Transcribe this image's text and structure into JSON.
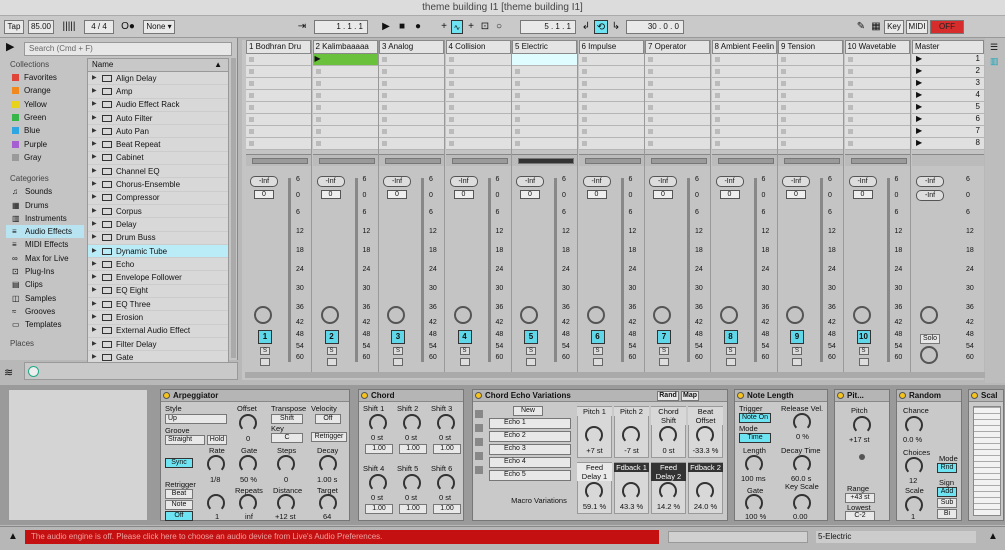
{
  "window": {
    "title": "theme building I1  [theme building I1]"
  },
  "toolbar": {
    "tap": "Tap",
    "tempo": "85.00",
    "meter": "4 / 4",
    "oo": "O●",
    "none": "None ▾",
    "pos1": "1 .   1 .   1",
    "pos2": "5 .   1 .   1",
    "pos3": "30 .   0 .   0",
    "key": "Key",
    "midi": "MIDI",
    "off": "OFF"
  },
  "browser": {
    "search_placeholder": "Search (Cmd + F)",
    "collections_header": "Collections",
    "collections": [
      {
        "label": "Favorites",
        "color": "#e0453a"
      },
      {
        "label": "Orange",
        "color": "#f08a1f"
      },
      {
        "label": "Yellow",
        "color": "#e8d21a"
      },
      {
        "label": "Green",
        "color": "#36b54a"
      },
      {
        "label": "Blue",
        "color": "#2fa6e0"
      },
      {
        "label": "Purple",
        "color": "#a65fd0"
      },
      {
        "label": "Gray",
        "color": "#9a9a9a"
      }
    ],
    "categories_header": "Categories",
    "categories": [
      "Sounds",
      "Drums",
      "Instruments",
      "Audio Effects",
      "MIDI Effects",
      "Max for Live",
      "Plug-Ins",
      "Clips",
      "Samples",
      "Grooves",
      "Templates"
    ],
    "places_header": "Places",
    "list_header": "Name",
    "items": [
      "Align Delay",
      "Amp",
      "Audio Effect Rack",
      "Auto Filter",
      "Auto Pan",
      "Beat Repeat",
      "Cabinet",
      "Channel EQ",
      "Chorus-Ensemble",
      "Compressor",
      "Corpus",
      "Delay",
      "Drum Buss",
      "Dynamic Tube",
      "Echo",
      "Envelope Follower",
      "EQ Eight",
      "EQ Three",
      "Erosion",
      "External Audio Effect",
      "Filter Delay",
      "Gate"
    ]
  },
  "tracks": [
    {
      "name": "1 Bodhran Dru",
      "num": "1"
    },
    {
      "name": "2 Kalimbaaaaa",
      "num": "2"
    },
    {
      "name": "3 Analog",
      "num": "3"
    },
    {
      "name": "4 Collision",
      "num": "4"
    },
    {
      "name": "5 Electric",
      "num": "5"
    },
    {
      "name": "6 Impulse",
      "num": "6"
    },
    {
      "name": "7 Operator",
      "num": "7"
    },
    {
      "name": "8 Ambient Feelin",
      "num": "8"
    },
    {
      "name": "9 Tension",
      "num": "9"
    },
    {
      "name": "10 Wavetable",
      "num": "10"
    }
  ],
  "mixer": {
    "inf": "-Inf",
    "zero": "0",
    "s": "S",
    "scale": [
      "6",
      "0",
      "6",
      "12",
      "18",
      "24",
      "30",
      "36",
      "42",
      "48",
      "54",
      "60"
    ]
  },
  "master": {
    "name": "Master",
    "scenes": [
      "1",
      "2",
      "3",
      "4",
      "5",
      "6",
      "7",
      "8"
    ],
    "inf": "-Inf",
    "solo": "Solo"
  },
  "devices": {
    "arp": {
      "title": "Arpeggiator",
      "style": "Style",
      "style_v": "Up",
      "groove": "Groove",
      "groove_v": "Straight",
      "hold": "Hold",
      "offset": "Offset",
      "offset_v": "0",
      "transpose": "Transpose",
      "shift": "Shift",
      "key": "Key",
      "key_v": "C",
      "velocity": "Velocity",
      "vel_off": "Off",
      "retrig": "Retrigger",
      "sync": "Sync",
      "rate": "Rate",
      "rate_v": "1/8",
      "gate": "Gate",
      "gate_v": "50 %",
      "steps": "Steps",
      "steps_v": "0",
      "decay": "Decay",
      "decay_v": "1.00 s",
      "retrigger": "Retrigger",
      "beat": "Beat",
      "note": "Note",
      "off": "Off",
      "repeats": "Repeats",
      "repeats_v": "inf",
      "one": "1",
      "distance": "Distance",
      "distance_v": "+12 st",
      "target": "Target",
      "target_v": "64"
    },
    "chord": {
      "title": "Chord",
      "shifts": [
        "Shift 1",
        "Shift 2",
        "Shift 3",
        "Shift 4",
        "Shift 5",
        "Shift 6"
      ],
      "st": "0 st",
      "box": "1.00"
    },
    "echo": {
      "title": "Chord Echo Variations",
      "rand": "Rand",
      "map": "Map",
      "new": "New",
      "echoes": [
        "Echo 1",
        "Echo 2",
        "Echo 3",
        "Echo 4",
        "Echo 5"
      ],
      "macro": "Macro Variations",
      "p1": "Pitch 1",
      "p1v": "+7 st",
      "p2": "Pitch 2",
      "p2v": "-7 st",
      "cs": "Chord Shift",
      "csv": "0 st",
      "bo": "Beat Offset",
      "bov": "-33.3 %",
      "fd1": "Feed Delay 1",
      "fd1v": "59.1 %",
      "fb1": "Fdback 1",
      "fb1v": "43.3 %",
      "fd2": "Feed Delay 2",
      "fd2v": "14.2 %",
      "fb2": "Fdback 2",
      "fb2v": "24.0 %"
    },
    "notelen": {
      "title": "Note Length",
      "trigger": "Trigger",
      "noteon": "Note On",
      "mode": "Mode",
      "time": "Time",
      "release": "Release Vel.",
      "release_v": "0 %",
      "length": "Length",
      "length_v": "100 ms",
      "decay": "Decay Time",
      "decay_v": "60.0 s",
      "gate": "Gate",
      "gate_v": "100 %",
      "keyscale": "Key Scale",
      "keyscale_v": "0.00"
    },
    "pitch": {
      "title": "Pit...",
      "pitch": "Pitch",
      "pitch_v": "+17 st",
      "range": "Range",
      "range_v": "+43 st",
      "lowest": "Lowest",
      "lowest_v": "C-2"
    },
    "random": {
      "title": "Random",
      "chance": "Chance",
      "chance_v": "0.0 %",
      "choices": "Choices",
      "choices_v": "12",
      "scale": "Scale",
      "scale_v": "1",
      "mode": "Mode",
      "rnd": "Rnd",
      "sign": "Sign",
      "add": "Add",
      "sub": "Sub",
      "bi": "Bi"
    },
    "scale": {
      "title": "Scal"
    }
  },
  "status": {
    "message": "The audio engine is off. Please click here to choose an audio device from Live's Audio Preferences.",
    "track": "5-Electric"
  }
}
